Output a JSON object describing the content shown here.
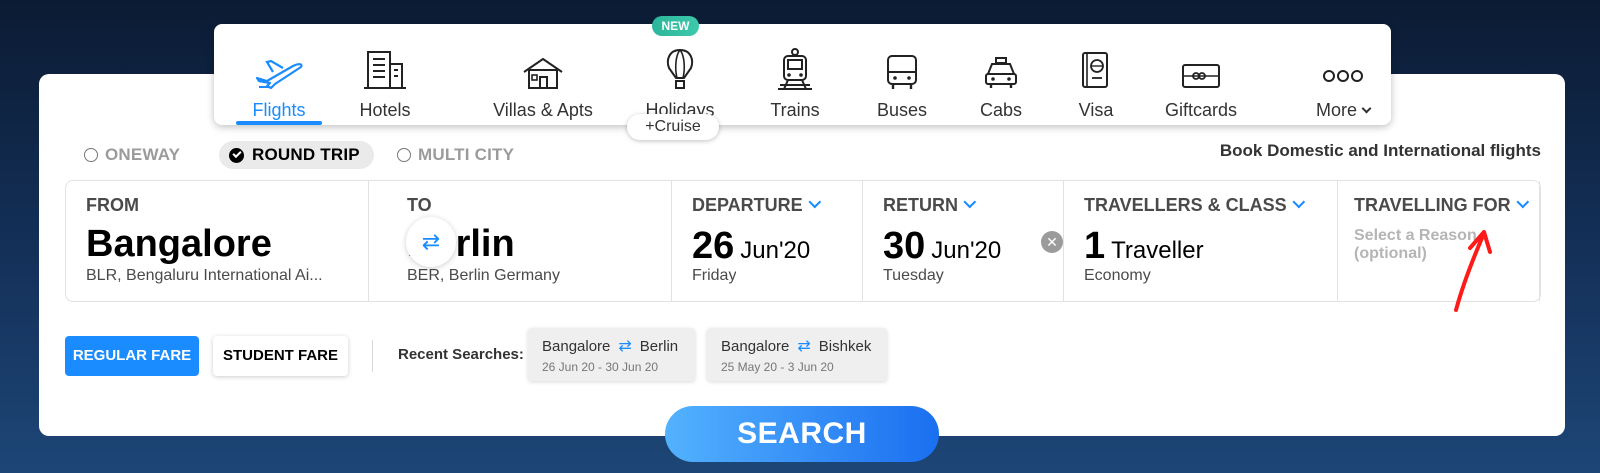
{
  "nav": {
    "items": [
      {
        "label": "Flights",
        "icon": "plane-icon"
      },
      {
        "label": "Hotels",
        "icon": "building-icon"
      },
      {
        "label": "Villas & Apts",
        "icon": "house-icon"
      },
      {
        "label": "Holidays",
        "icon": "balloon-icon"
      },
      {
        "label": "Trains",
        "icon": "train-icon"
      },
      {
        "label": "Buses",
        "icon": "bus-icon"
      },
      {
        "label": "Cabs",
        "icon": "cab-icon"
      },
      {
        "label": "Visa",
        "icon": "passport-icon"
      },
      {
        "label": "Giftcards",
        "icon": "giftcard-icon"
      },
      {
        "label": "More",
        "icon": "more-dots-icon"
      }
    ],
    "new_badge": "NEW",
    "cruise_label": "+Cruise"
  },
  "trip_types": [
    "ONEWAY",
    "ROUND TRIP",
    "MULTI CITY"
  ],
  "book_text": "Book Domestic and International flights",
  "from": {
    "caption": "FROM",
    "city": "Bangalore",
    "detail": "BLR, Bengaluru International Ai..."
  },
  "to": {
    "caption": "TO",
    "city": "Berlin",
    "detail": "BER, Berlin Germany"
  },
  "departure": {
    "caption": "DEPARTURE",
    "day": "26",
    "month": "Jun'20",
    "weekday": "Friday"
  },
  "return": {
    "caption": "RETURN",
    "day": "30",
    "month": "Jun'20",
    "weekday": "Tuesday"
  },
  "travellers": {
    "caption": "TRAVELLERS & CLASS",
    "count": "1",
    "unit": "Traveller",
    "class": "Economy"
  },
  "travelling_for": {
    "caption": "TRAVELLING FOR",
    "line1": "Select a Reason",
    "line2": "(optional)"
  },
  "fares": {
    "regular": "REGULAR FARE",
    "student": "STUDENT FARE"
  },
  "recent_label": "Recent Searches:",
  "recent_searches": [
    {
      "from": "Bangalore",
      "to": "Berlin",
      "dates": "26 Jun 20 - 30 Jun 20"
    },
    {
      "from": "Bangalore",
      "to": "Bishkek",
      "dates": "25 May 20 - 3 Jun 20"
    }
  ],
  "search_label": "SEARCH",
  "colors": {
    "accent": "#1a8cff",
    "annotation": "#ff1a1a"
  }
}
